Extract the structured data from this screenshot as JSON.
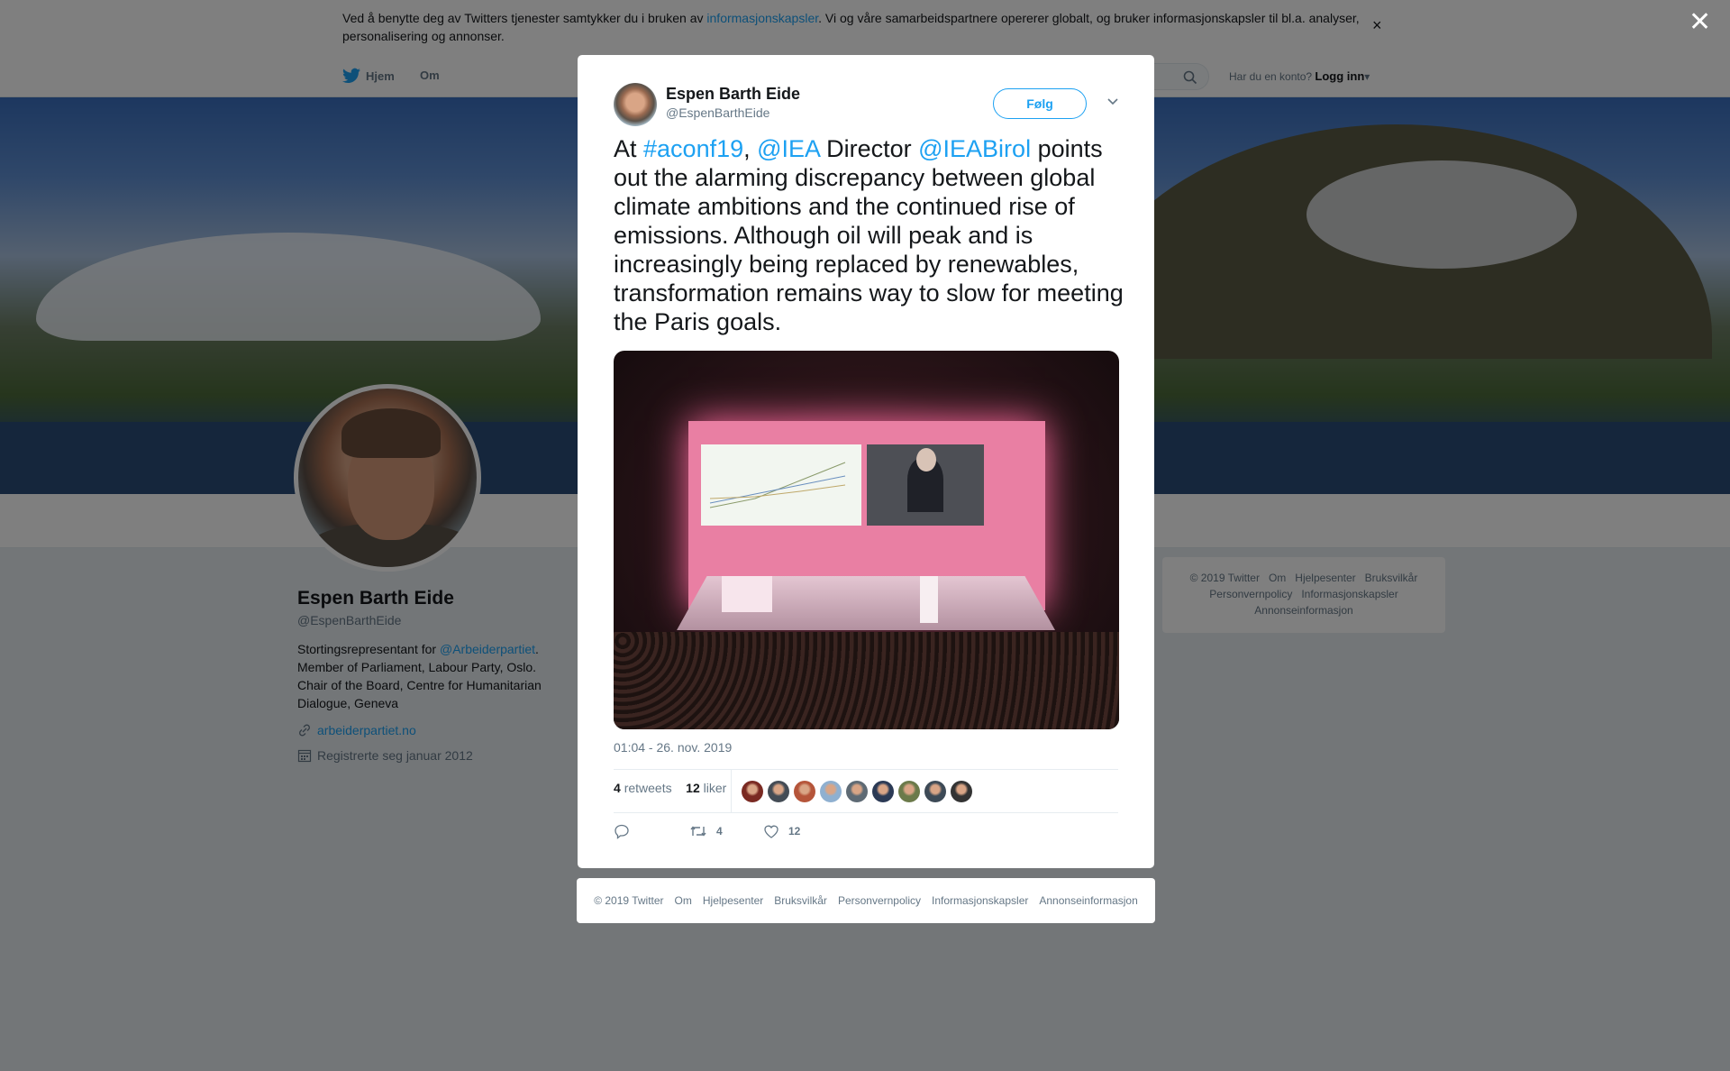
{
  "cookie_bar": {
    "text_before": "Ved å benytte deg av Twitters tjenester samtykker du i bruken av ",
    "link": "informasjonskapsler",
    "text_after": ". Vi og våre samarbeidspartnere opererer globalt, og bruker informasjonskapsler til bl.a. analyser, personalisering og annonser."
  },
  "nav": {
    "home": "Hjem",
    "about": "Om",
    "login_prompt": "Har du en konto?",
    "login": "Logg inn"
  },
  "profile": {
    "name": "Espen Barth Eide",
    "handle": "@EspenBarthEide",
    "bio_before": "Stortingsrepresentant for ",
    "bio_link": "@Arbeiderpartiet",
    "bio_after": ". Member of Parliament, Labour Party, Oslo. Chair of the Board, Centre for Humanitarian Dialogue, Geneva",
    "website": "arbeiderpartiet.no",
    "joined": "Registrerte seg januar 2012"
  },
  "side_footer": [
    "© 2019 Twitter",
    "Om",
    "Hjelpesenter",
    "Bruksvilkår",
    "Personvernpolicy",
    "Informasjonskapsler",
    "Annonseinformasjon"
  ],
  "tweet": {
    "author_name": "Espen Barth Eide",
    "author_handle": "@EspenBarthEide",
    "follow_label": "Følg",
    "text_parts": [
      {
        "t": "At ",
        "link": false
      },
      {
        "t": "#aconf19",
        "link": true
      },
      {
        "t": ", ",
        "link": false
      },
      {
        "t": "@IEA",
        "link": true
      },
      {
        "t": " Director ",
        "link": false
      },
      {
        "t": "@IEABirol",
        "link": true
      },
      {
        "t": " points out the alarming discrepancy between global climate ambitions and the continued rise of emissions. Although oil will peak and is increasingly being replaced by renewables, transformation remains way to slow for meeting the Paris goals.",
        "link": false
      }
    ],
    "timestamp": "01:04 - 26. nov. 2019",
    "retweets_count": "4",
    "retweets_label": "retweets",
    "likes_count": "12",
    "likes_label": "liker",
    "action_retweet_count": "4",
    "action_like_count": "12",
    "liker_colors": [
      "#7a2a22",
      "#444c55",
      "#b5553a",
      "#8fb0d0",
      "#5e6a74",
      "#2b3a55",
      "#6b7a4a",
      "#3d4a56",
      "#333"
    ]
  },
  "modal_footer": [
    "© 2019 Twitter",
    "Om",
    "Hjelpesenter",
    "Bruksvilkår",
    "Personvernpolicy",
    "Informasjonskapsler",
    "Annonseinformasjon"
  ],
  "colors": {
    "accent": "#1da1f2",
    "overlay": "rgba(0,0,0,0.5)"
  }
}
